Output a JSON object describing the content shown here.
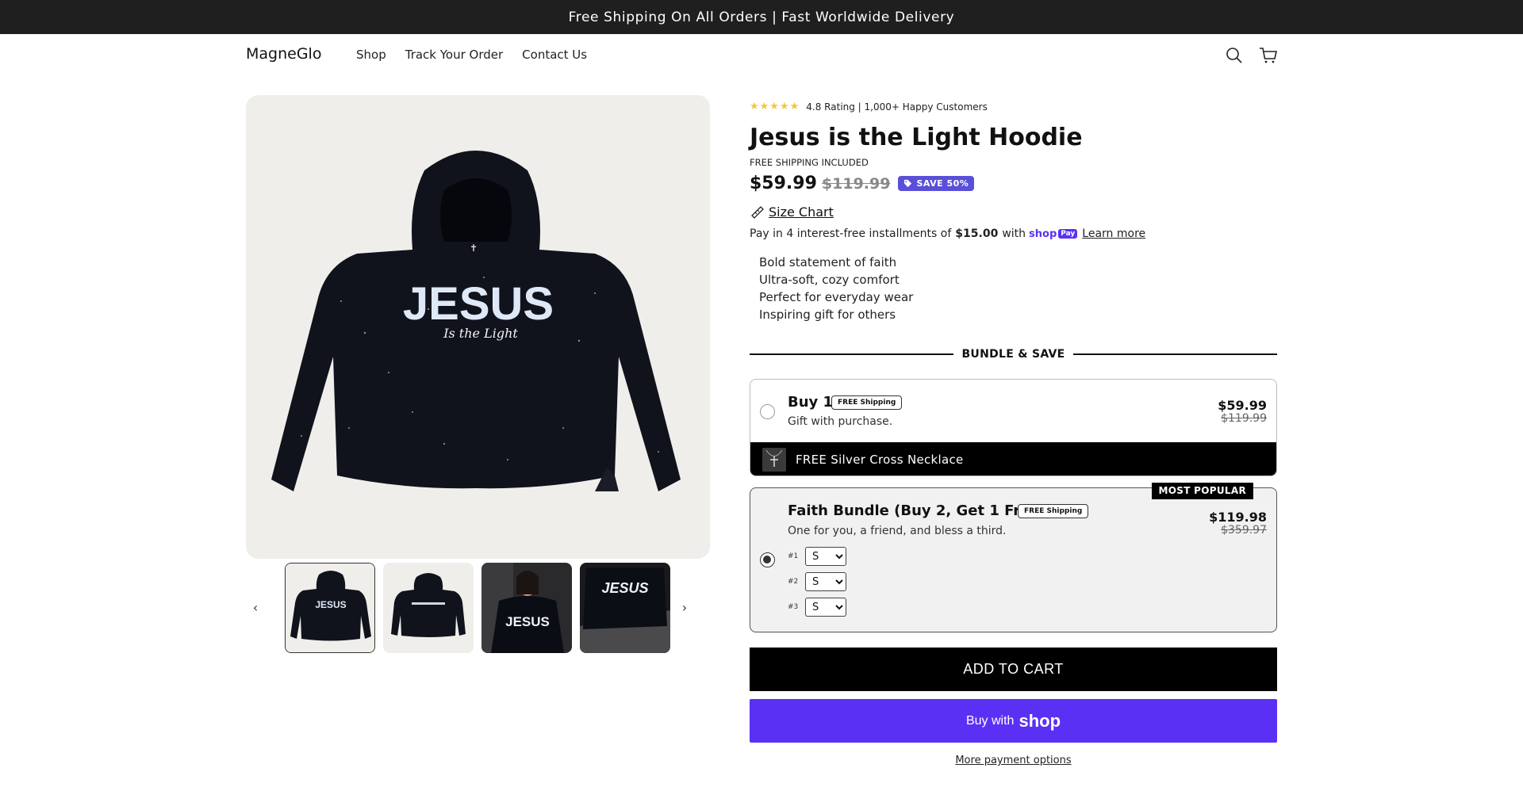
{
  "announcement": "Free Shipping On All Orders | Fast Worldwide Delivery",
  "header": {
    "logo": "MagneGlo",
    "nav": [
      "Shop",
      "Track Your Order",
      "Contact Us"
    ],
    "icons": [
      "search-icon",
      "cart-icon"
    ]
  },
  "gallery": {
    "main_image_text": "JESUS",
    "main_image_subtext": "Is the Light",
    "thumbnail_count": 4,
    "active_thumbnail": 1,
    "prev_label": "‹",
    "next_label": "›"
  },
  "product": {
    "stars": "★★★★★",
    "rating_text": "4.8 Rating | 1,000+ Happy Customers",
    "title": "Jesus is the Light Hoodie",
    "shipping_note": "FREE SHIPPING INCLUDED",
    "price": "$59.99",
    "compare_price": "$119.99",
    "save_badge": "SAVE 50%",
    "size_chart": "Size Chart",
    "installments_prefix": "Pay in 4 interest-free installments of",
    "installments_amount": "$15.00",
    "installments_with": "with",
    "shoppay_word": "shop",
    "shoppay_pay": "Pay",
    "learn_more": "Learn more",
    "bullets": [
      "Bold statement of faith",
      "Ultra-soft, cozy comfort",
      "Perfect for everyday wear",
      "Inspiring gift for others"
    ]
  },
  "bundle": {
    "heading": "BUNDLE & SAVE",
    "offers": [
      {
        "title": "Buy 1",
        "chip": "FREE Shipping",
        "subtitle": "Gift with purchase.",
        "price": "$59.99",
        "compare": "$119.99",
        "gift": "FREE Silver Cross Necklace",
        "selected": false
      },
      {
        "title": "Faith Bundle (Buy 2, Get 1 Free)",
        "chip": "FREE Shipping",
        "subtitle": "One for you, a friend, and bless a third.",
        "price": "$119.98",
        "compare": "$359.97",
        "badge": "MOST POPULAR",
        "selected": true,
        "selectors": [
          {
            "label": "#1",
            "value": "S"
          },
          {
            "label": "#2",
            "value": "S"
          },
          {
            "label": "#3",
            "value": "S"
          }
        ]
      }
    ]
  },
  "actions": {
    "add_to_cart": "ADD TO CART",
    "buy_with": "Buy with",
    "shop_logo": "shop",
    "more_options": "More payment options"
  },
  "colors": {
    "accent": "#5a31f4",
    "badge": "#5a4fd8",
    "stars": "#f1c83a",
    "announcement_bg": "#1f1f1f"
  }
}
